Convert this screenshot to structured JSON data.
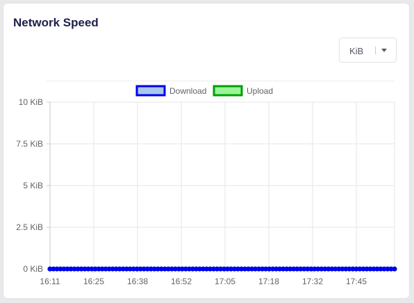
{
  "card": {
    "title": "Network Speed"
  },
  "unit_selector": {
    "value": "KiB"
  },
  "colors": {
    "download_stroke": "#0000ee",
    "download_fill": "#a9c7ef",
    "upload_stroke": "#00a000",
    "upload_fill": "#98f598",
    "grid": "#e6e6e6",
    "axis": "#c8c8c8"
  },
  "chart_data": {
    "type": "line",
    "title": "",
    "xlabel": "",
    "ylabel": "",
    "legend_position": "top",
    "grid": true,
    "y_tick_labels": [
      "0 KiB",
      "2.5 KiB",
      "5 KiB",
      "7.5 KiB",
      "10 KiB"
    ],
    "y_ticks": [
      0,
      2.5,
      5,
      7.5,
      10
    ],
    "ylim": [
      0,
      10
    ],
    "x_tick_labels": [
      "16:11",
      "16:25",
      "16:38",
      "16:52",
      "17:05",
      "17:18",
      "17:32",
      "17:45"
    ],
    "x_point_count": 100,
    "series": [
      {
        "name": "Download",
        "stroke": "#0000ee",
        "fill": "#a9c7ef",
        "values": [
          0,
          0,
          0,
          0,
          0,
          0,
          0,
          0,
          0,
          0,
          0,
          0,
          0,
          0,
          0,
          0,
          0,
          0,
          0,
          0,
          0,
          0,
          0,
          0,
          0,
          0,
          0,
          0,
          0,
          0,
          0,
          0,
          0,
          0,
          0,
          0,
          0,
          0,
          0,
          0,
          0,
          0,
          0,
          0,
          0,
          0,
          0,
          0,
          0,
          0,
          0,
          0,
          0,
          0,
          0,
          0,
          0,
          0,
          0,
          0,
          0,
          0,
          0,
          0,
          0,
          0,
          0,
          0,
          0,
          0,
          0,
          0,
          0,
          0,
          0,
          0,
          0,
          0,
          0,
          0,
          0,
          0,
          0,
          0,
          0,
          0,
          0,
          0,
          0,
          0,
          0,
          0,
          0,
          0,
          0,
          0,
          0,
          0,
          0,
          0
        ]
      },
      {
        "name": "Upload",
        "stroke": "#00a000",
        "fill": "#98f598",
        "values": [
          0,
          0,
          0,
          0,
          0,
          0,
          0,
          0,
          0,
          0,
          0,
          0,
          0,
          0,
          0,
          0,
          0,
          0,
          0,
          0,
          0,
          0,
          0,
          0,
          0,
          0,
          0,
          0,
          0,
          0,
          0,
          0,
          0,
          0,
          0,
          0,
          0,
          0,
          0,
          0,
          0,
          0,
          0,
          0,
          0,
          0,
          0,
          0,
          0,
          0,
          0,
          0,
          0,
          0,
          0,
          0,
          0,
          0,
          0,
          0,
          0,
          0,
          0,
          0,
          0,
          0,
          0,
          0,
          0,
          0,
          0,
          0,
          0,
          0,
          0,
          0,
          0,
          0,
          0,
          0,
          0,
          0,
          0,
          0,
          0,
          0,
          0,
          0,
          0,
          0,
          0,
          0,
          0,
          0,
          0,
          0,
          0,
          0,
          0,
          0
        ]
      }
    ]
  }
}
